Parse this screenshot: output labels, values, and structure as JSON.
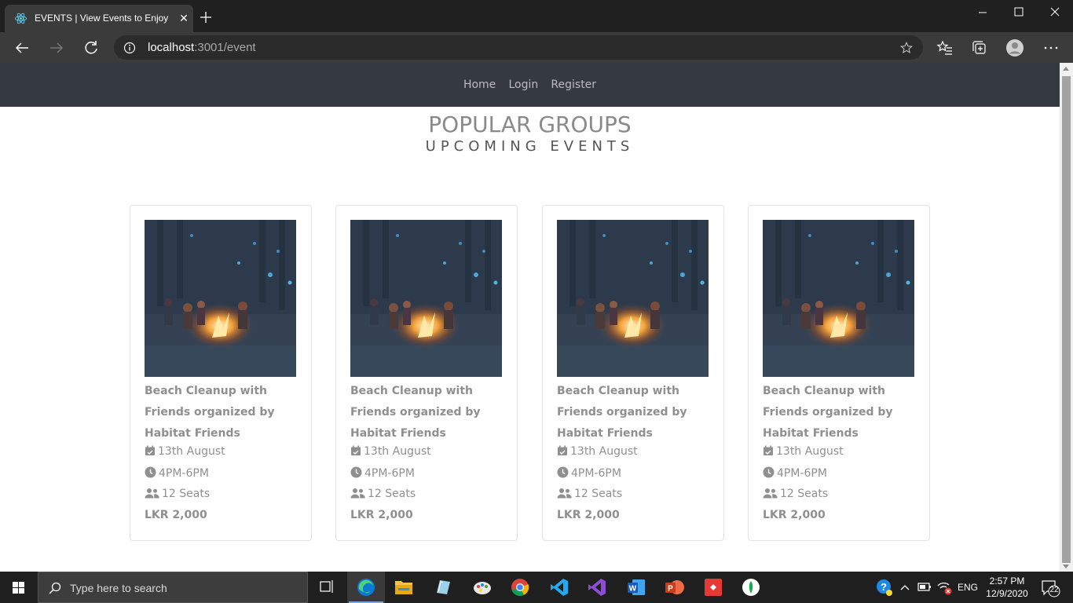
{
  "browser": {
    "tab_title": "EVENTS | View Events to Enjoy",
    "url_host": "localhost",
    "url_rest": ":3001/event"
  },
  "site_nav": {
    "links": [
      "Home",
      "Login",
      "Register"
    ]
  },
  "page": {
    "heading": "POPULAR GROUPS",
    "subheading": "UPCOMING EVENTS"
  },
  "events": [
    {
      "title": "Beach Cleanup with Friends organized by Habitat Friends",
      "date": "13th August",
      "time": "4PM-6PM",
      "seats": "12 Seats",
      "price": "LKR 2,000"
    },
    {
      "title": "Beach Cleanup with Friends organized by Habitat Friends",
      "date": "13th August",
      "time": "4PM-6PM",
      "seats": "12 Seats",
      "price": "LKR 2,000"
    },
    {
      "title": "Beach Cleanup with Friends organized by Habitat Friends",
      "date": "13th August",
      "time": "4PM-6PM",
      "seats": "12 Seats",
      "price": "LKR 2,000"
    },
    {
      "title": "Beach Cleanup with Friends organized by Habitat Friends",
      "date": "13th August",
      "time": "4PM-6PM",
      "seats": "12 Seats",
      "price": "LKR 2,000"
    }
  ],
  "taskbar": {
    "search_placeholder": "Type here to search",
    "language": "ENG",
    "time": "2:57 PM",
    "date": "12/9/2020",
    "notification_count": "22"
  },
  "icons": {
    "event_image": "campfire-photo",
    "date_icon": "calendar-check-icon",
    "time_icon": "clock-icon",
    "seats_icon": "users-icon"
  },
  "colors": {
    "site_nav_bg": "#343a40",
    "card_text": "#8f8f8f",
    "browser_chrome": "#202020"
  }
}
